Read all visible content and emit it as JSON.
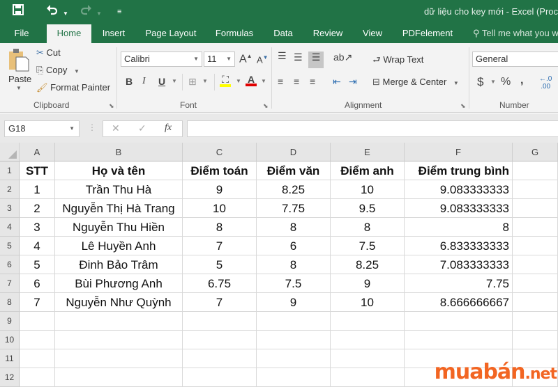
{
  "window": {
    "title": "dữ liệu cho key mới - Excel (Proc"
  },
  "quick_access": {
    "save_icon": "save-icon",
    "undo_icon": "undo-icon",
    "redo_icon": "redo-icon",
    "customize_icon": "customize-qat-icon"
  },
  "tabs": [
    {
      "label": "File",
      "active": false
    },
    {
      "label": "Home",
      "active": true
    },
    {
      "label": "Insert",
      "active": false
    },
    {
      "label": "Page Layout",
      "active": false
    },
    {
      "label": "Formulas",
      "active": false
    },
    {
      "label": "Data",
      "active": false
    },
    {
      "label": "Review",
      "active": false
    },
    {
      "label": "View",
      "active": false
    },
    {
      "label": "PDFelement",
      "active": false
    }
  ],
  "tell_me": {
    "placeholder": "Tell me what you w",
    "icon": "lightbulb-icon"
  },
  "ribbon": {
    "clipboard": {
      "label": "Clipboard",
      "paste": "Paste",
      "cut": "Cut",
      "copy": "Copy",
      "format_painter": "Format Painter"
    },
    "font": {
      "label": "Font",
      "font_name": "Calibri",
      "font_size": "11",
      "grow": "A",
      "shrink": "A",
      "bold": "B",
      "italic": "I",
      "underline": "U",
      "fill_color": "#ffff00",
      "font_color": "#e00000"
    },
    "alignment": {
      "label": "Alignment",
      "wrap_text": "Wrap Text",
      "merge_center": "Merge & Center"
    },
    "number": {
      "label": "Number",
      "format": "General",
      "currency": "$",
      "percent": "%",
      "comma": ","
    }
  },
  "formula_bar": {
    "name_box": "G18",
    "cancel": "✕",
    "enter": "✓",
    "fx": "fx",
    "value": ""
  },
  "sheet": {
    "columns": [
      "A",
      "B",
      "C",
      "D",
      "E",
      "F",
      "G"
    ],
    "row_numbers": [
      "1",
      "2",
      "3",
      "4",
      "5",
      "6",
      "7",
      "8",
      "9",
      "10",
      "11",
      "12"
    ],
    "header": [
      "STT",
      "Họ và tên",
      "Điểm toán",
      "Điểm văn",
      "Điểm anh",
      "Điểm trung bình",
      ""
    ],
    "rows": [
      [
        "1",
        "Trần Thu Hà",
        "9",
        "8.25",
        "10",
        "9.083333333",
        ""
      ],
      [
        "2",
        "Nguyễn Thị Hà Trang",
        "10",
        "7.75",
        "9.5",
        "9.083333333",
        ""
      ],
      [
        "3",
        "Nguyễn Thu Hiền",
        "8",
        "8",
        "8",
        "8",
        ""
      ],
      [
        "4",
        "Lê Huyền Anh",
        "7",
        "6",
        "7.5",
        "6.833333333",
        ""
      ],
      [
        "5",
        "Đinh Bảo Trâm",
        "5",
        "8",
        "8.25",
        "7.083333333",
        ""
      ],
      [
        "6",
        "Bùi Phương Anh",
        "6.75",
        "7.5",
        "9",
        "7.75",
        ""
      ],
      [
        "7",
        "Nguyễn Như Quỳnh",
        "7",
        "9",
        "10",
        "8.666666667",
        ""
      ]
    ]
  },
  "watermark": {
    "brand": "muabán",
    "tld": ".net",
    "color": "#f26522"
  }
}
